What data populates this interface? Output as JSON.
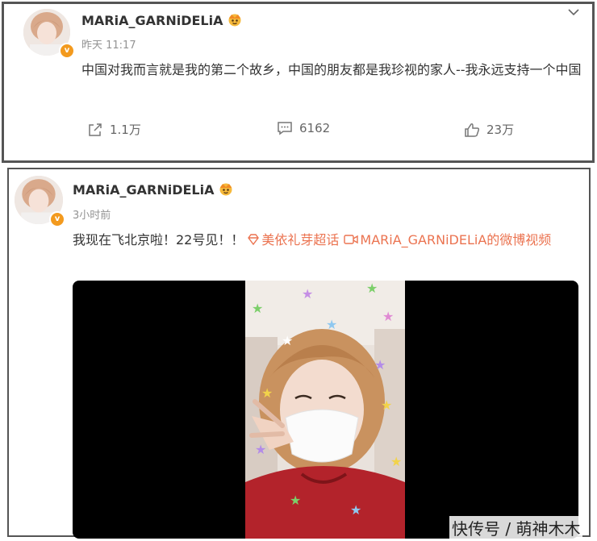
{
  "post1": {
    "username": "MARiA_GARNiDELiA",
    "time": "昨天 11:17",
    "text": "中国对我而言就是我的第二个故乡，中国的朋友都是我珍视的家人--我永远支持一个中国",
    "actions": {
      "repost": "1.1万",
      "comments": "6162",
      "likes": "23万"
    },
    "verified_badge": "v"
  },
  "post2": {
    "username": "MARiA_GARNiDELiA",
    "time": "3小时前",
    "text": "我现在飞北京啦！22号见！！",
    "topic_link": "美依礼芽超话",
    "video_link": "MARiA_GARNiDELiA的微博视频",
    "verified_badge": "v"
  },
  "watermark": "快传号 / 萌神木木",
  "colors": {
    "link": "#eb7350",
    "badge": "#f39a1e",
    "border": "#555555"
  },
  "icons": [
    "crown-icon",
    "chevron-down-icon",
    "repost-icon",
    "comment-icon",
    "like-icon",
    "topic-icon",
    "video-icon"
  ]
}
